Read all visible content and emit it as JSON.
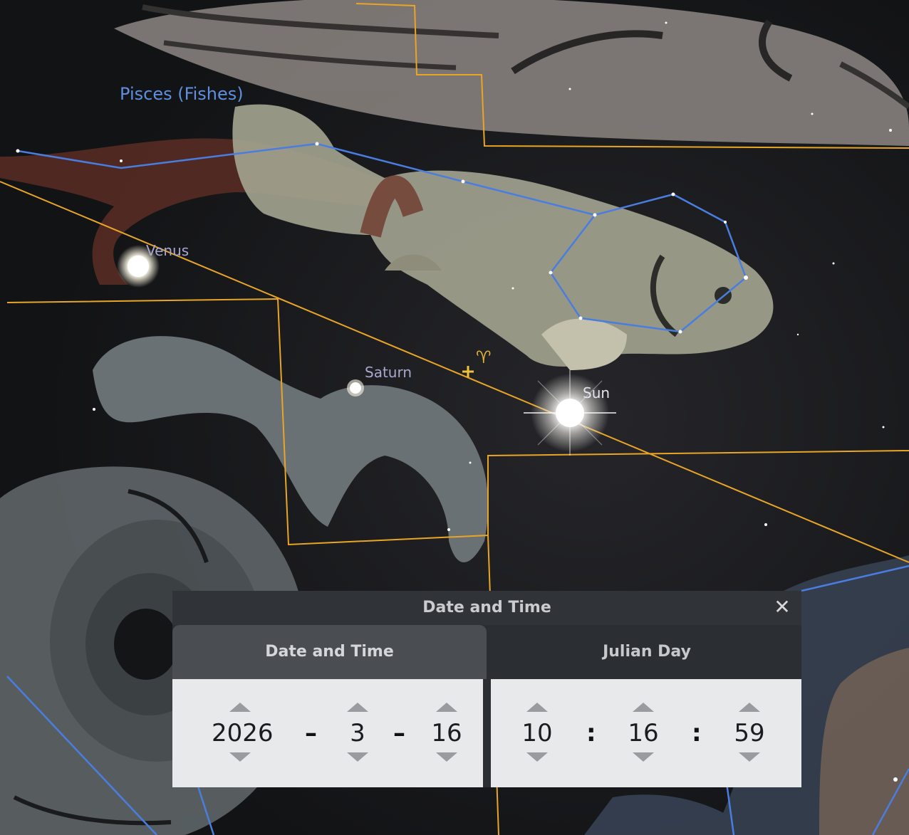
{
  "sky": {
    "constellation_label": "Pisces (Fishes)",
    "planets": {
      "venus": "Venus",
      "saturn": "Saturn",
      "sun": "Sun"
    },
    "aries_symbol": "♈"
  },
  "dialog": {
    "title": "Date and Time",
    "close_icon": "close-icon",
    "tabs": [
      {
        "label": "Date and Time",
        "active": true
      },
      {
        "label": "Julian Day",
        "active": false
      }
    ],
    "date": {
      "year": "2026",
      "month": "3",
      "day": "16",
      "separator": "–"
    },
    "time": {
      "hour": "10",
      "minute": "16",
      "second": "59",
      "separator": ":"
    }
  },
  "colors": {
    "constellation_lines": "#4a7de0",
    "boundaries": "#e8a526",
    "panel_bg": "#e8e9eb",
    "dialog_bg": "#2b2e33"
  }
}
